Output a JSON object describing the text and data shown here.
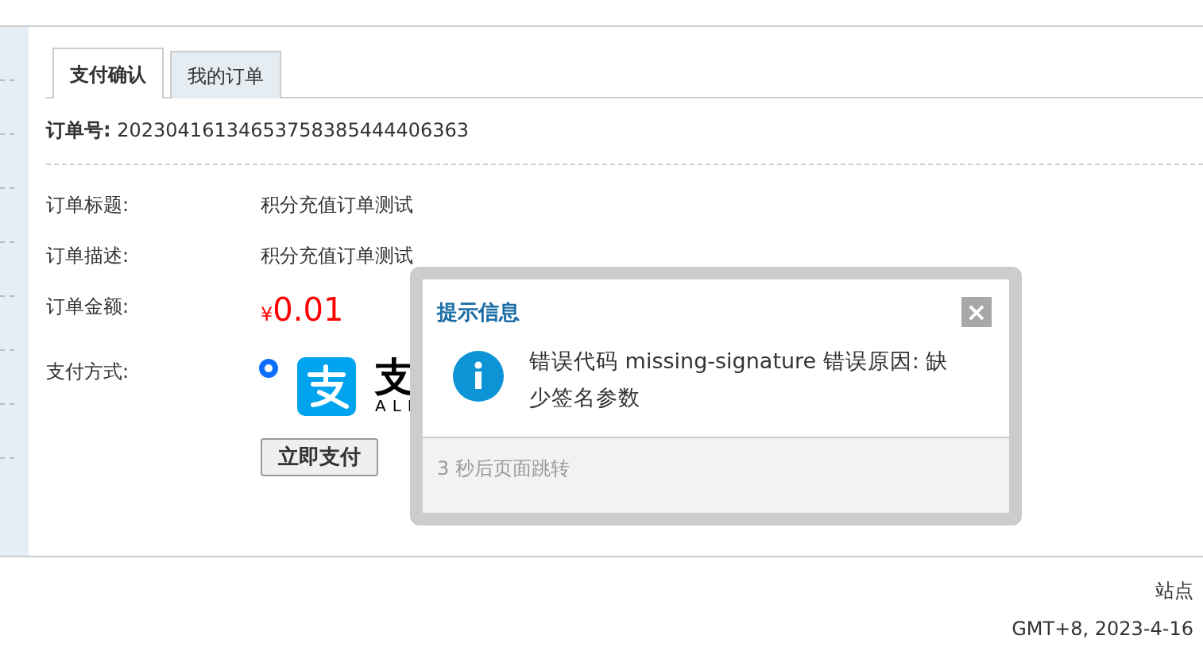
{
  "tabs": [
    {
      "label": "支付确认",
      "selected": true
    },
    {
      "label": "我的订单",
      "selected": false
    }
  ],
  "order_number": {
    "label": "订单号:",
    "value": "20230416134653758385444406363"
  },
  "fields": [
    {
      "kind": "text",
      "label": "订单标题:",
      "value": "积分充值订单测试"
    },
    {
      "kind": "text",
      "label": "订单描述:",
      "value": "积分充值订单测试"
    },
    {
      "kind": "amount",
      "label": "订单金额:",
      "currency": "¥",
      "value": "0.01"
    }
  ],
  "payment": {
    "label": "支付方式:",
    "methods": [
      {
        "selected": true,
        "logo_text": "支",
        "logo_subtext": "ALI"
      }
    ]
  },
  "pay_button": "立即支付",
  "dialog": {
    "title": "提示信息",
    "close": "×",
    "message": "错误代码 missing-signature 错误原因: 缺少签名参数",
    "footer": "3 秒后页面跳转"
  },
  "footer": {
    "site": "站点",
    "time": "GMT+8, 2023-4-16"
  }
}
